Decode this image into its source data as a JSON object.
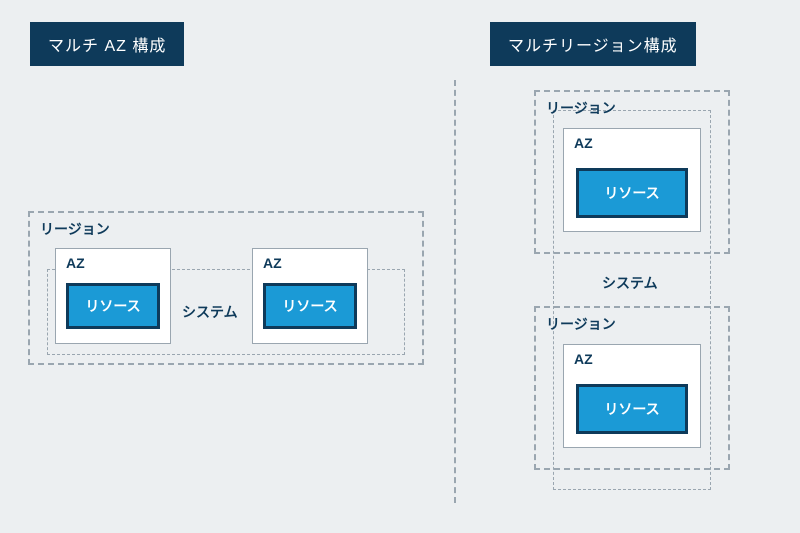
{
  "left": {
    "title": "マルチ AZ 構成",
    "region_label": "リージョン",
    "az_label": "AZ",
    "resource_label": "リソース",
    "system_label": "システム"
  },
  "right": {
    "title": "マルチリージョン構成",
    "region_label": "リージョン",
    "az_label": "AZ",
    "resource_label": "リソース",
    "system_label": "システム"
  }
}
